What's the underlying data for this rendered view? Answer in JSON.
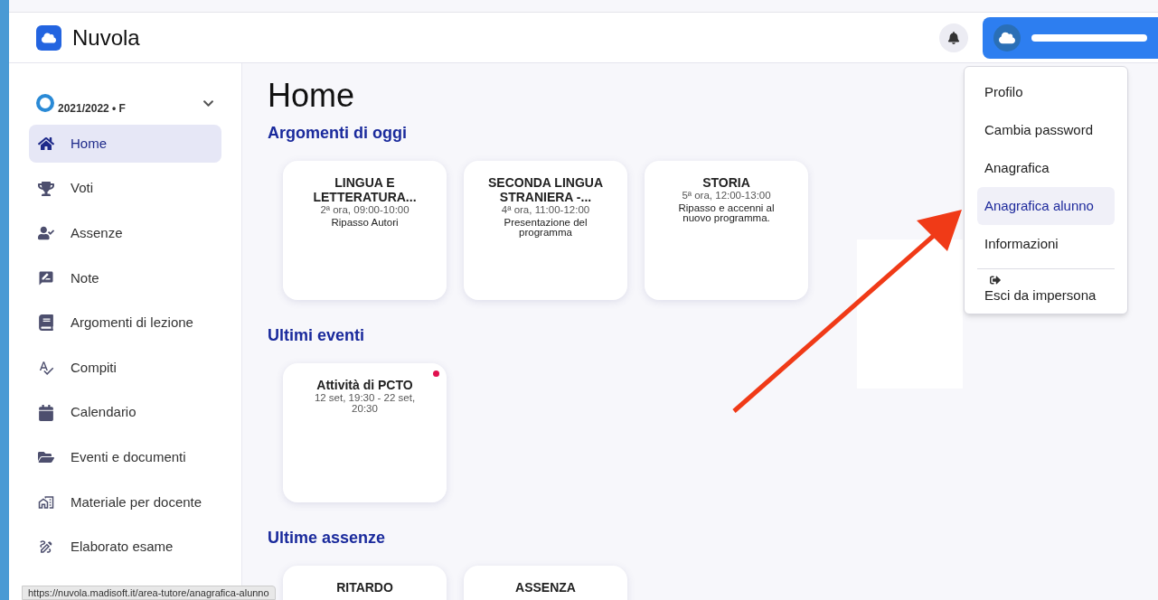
{
  "app": {
    "name": "Nuvola"
  },
  "sidebar": {
    "year": "2021/2022 • F",
    "items": [
      {
        "label": "Home",
        "selected": true
      },
      {
        "label": "Voti",
        "selected": false
      },
      {
        "label": "Assenze",
        "selected": false
      },
      {
        "label": "Note",
        "selected": false
      },
      {
        "label": "Argomenti di lezione",
        "selected": false
      },
      {
        "label": "Compiti",
        "selected": false
      },
      {
        "label": "Calendario",
        "selected": false
      },
      {
        "label": "Eventi e documenti",
        "selected": false
      },
      {
        "label": "Materiale per docente",
        "selected": false
      },
      {
        "label": "Elaborato esame",
        "selected": false
      }
    ]
  },
  "page": {
    "title": "Home"
  },
  "sections": [
    {
      "title": "Argomenti di oggi",
      "cards": [
        {
          "title": "LINGUA E LETTERATURA...",
          "subtitle": "2ª ora, 09:00-10:00",
          "text": "Ripasso Autori",
          "unread": false
        },
        {
          "title": "SECONDA LINGUA STRANIERA -...",
          "subtitle": "4ª ora, 11:00-12:00",
          "text": "Presentazione del programma",
          "unread": false
        },
        {
          "title": "STORIA",
          "subtitle": "5ª ora, 12:00-13:00",
          "text": "Ripasso e accenni al nuovo programma.",
          "unread": false
        }
      ]
    },
    {
      "title": "Ultimi eventi",
      "cards": [
        {
          "title": "Attività di PCTO",
          "subtitle": "12 set, 19:30 - 22 set, 20:30",
          "unread": true
        }
      ]
    },
    {
      "title": "Ultime assenze",
      "cards": [
        {
          "title": "RITARDO",
          "unread": false
        },
        {
          "title": "ASSENZA",
          "unread": false
        }
      ]
    }
  ],
  "user_menu": {
    "items": [
      {
        "label": "Profilo",
        "selected": false
      },
      {
        "label": "Cambia password",
        "selected": false
      },
      {
        "label": "Anagrafica",
        "selected": false
      },
      {
        "label": "Anagrafica alunno",
        "selected": true
      },
      {
        "label": "Informazioni",
        "selected": false
      }
    ],
    "exit": {
      "label": "Esci da impersona"
    }
  },
  "status_bar": {
    "url": "https://nuvola.madisoft.it/area-tutore/anagrafica-alunno"
  }
}
